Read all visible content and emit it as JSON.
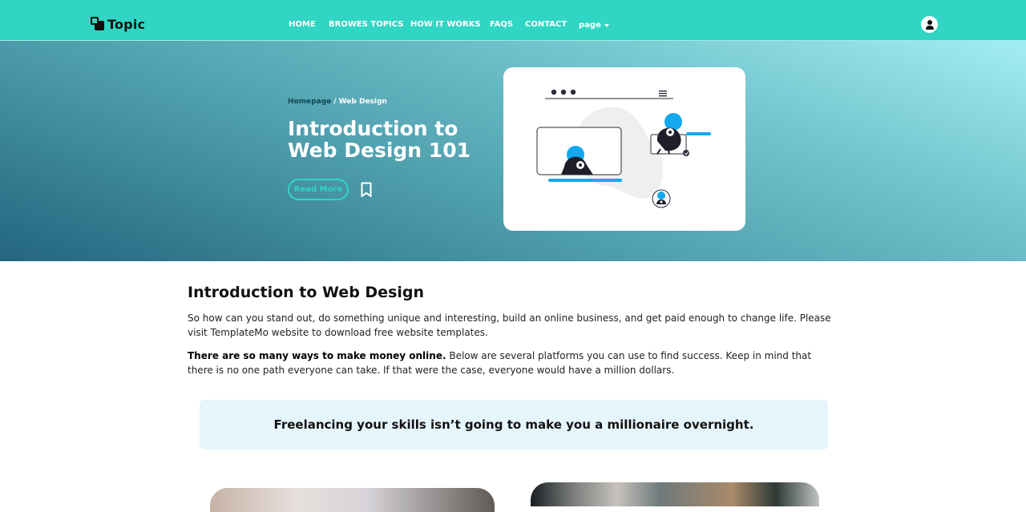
{
  "brand": {
    "name": "Topic"
  },
  "nav": {
    "links": [
      "HOME",
      "BROWES TOPICS",
      "HOW IT WORKS",
      "FAQS",
      "CONTACT"
    ],
    "dropdown_label": "page"
  },
  "hero": {
    "breadcrumb": {
      "home": "Homepage",
      "current": "/ Web Design"
    },
    "title": "Introduction to Web Design 101",
    "read_more_label": "Read More"
  },
  "article": {
    "title": "Introduction to Web Design",
    "paragraph1": "So how can you stand out, do something unique and interesting, build an online business, and get paid enough to change life. Please visit TemplateMo website to download free website templates.",
    "paragraph2_strong": "There are so many ways to make money online.",
    "paragraph2_rest": " Below are several platforms you can use to find success. Keep in mind that there is no one path everyone can take. If that were the case, everyone would have a million dollars.",
    "quote": "Freelancing your skills isn’t going to make you a millionaire overnight."
  },
  "colors": {
    "primary": "#30d6c3",
    "hero_dark": "#24667e",
    "hero_light": "#a3eef3",
    "quote_bg": "#e5f5fb",
    "illustration_blue": "#13a8f0"
  },
  "icons": {
    "user": "user-icon",
    "bookmark": "bookmark-icon",
    "caret": "chevron-down-icon"
  }
}
